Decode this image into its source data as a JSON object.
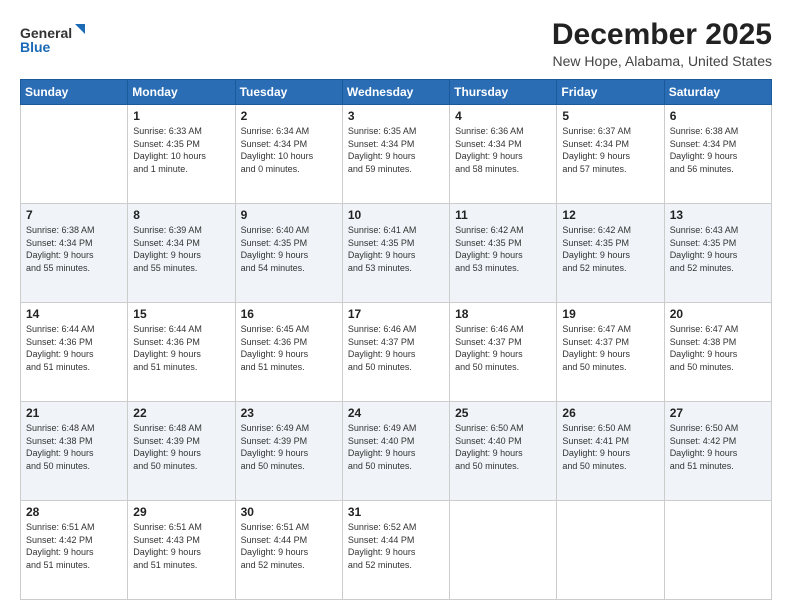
{
  "header": {
    "logo_line1": "General",
    "logo_line2": "Blue",
    "title": "December 2025",
    "subtitle": "New Hope, Alabama, United States"
  },
  "days_of_week": [
    "Sunday",
    "Monday",
    "Tuesday",
    "Wednesday",
    "Thursday",
    "Friday",
    "Saturday"
  ],
  "weeks": [
    [
      {
        "day": "",
        "content": ""
      },
      {
        "day": "1",
        "content": "Sunrise: 6:33 AM\nSunset: 4:35 PM\nDaylight: 10 hours\nand 1 minute."
      },
      {
        "day": "2",
        "content": "Sunrise: 6:34 AM\nSunset: 4:34 PM\nDaylight: 10 hours\nand 0 minutes."
      },
      {
        "day": "3",
        "content": "Sunrise: 6:35 AM\nSunset: 4:34 PM\nDaylight: 9 hours\nand 59 minutes."
      },
      {
        "day": "4",
        "content": "Sunrise: 6:36 AM\nSunset: 4:34 PM\nDaylight: 9 hours\nand 58 minutes."
      },
      {
        "day": "5",
        "content": "Sunrise: 6:37 AM\nSunset: 4:34 PM\nDaylight: 9 hours\nand 57 minutes."
      },
      {
        "day": "6",
        "content": "Sunrise: 6:38 AM\nSunset: 4:34 PM\nDaylight: 9 hours\nand 56 minutes."
      }
    ],
    [
      {
        "day": "7",
        "content": "Sunrise: 6:38 AM\nSunset: 4:34 PM\nDaylight: 9 hours\nand 55 minutes."
      },
      {
        "day": "8",
        "content": "Sunrise: 6:39 AM\nSunset: 4:34 PM\nDaylight: 9 hours\nand 55 minutes."
      },
      {
        "day": "9",
        "content": "Sunrise: 6:40 AM\nSunset: 4:35 PM\nDaylight: 9 hours\nand 54 minutes."
      },
      {
        "day": "10",
        "content": "Sunrise: 6:41 AM\nSunset: 4:35 PM\nDaylight: 9 hours\nand 53 minutes."
      },
      {
        "day": "11",
        "content": "Sunrise: 6:42 AM\nSunset: 4:35 PM\nDaylight: 9 hours\nand 53 minutes."
      },
      {
        "day": "12",
        "content": "Sunrise: 6:42 AM\nSunset: 4:35 PM\nDaylight: 9 hours\nand 52 minutes."
      },
      {
        "day": "13",
        "content": "Sunrise: 6:43 AM\nSunset: 4:35 PM\nDaylight: 9 hours\nand 52 minutes."
      }
    ],
    [
      {
        "day": "14",
        "content": "Sunrise: 6:44 AM\nSunset: 4:36 PM\nDaylight: 9 hours\nand 51 minutes."
      },
      {
        "day": "15",
        "content": "Sunrise: 6:44 AM\nSunset: 4:36 PM\nDaylight: 9 hours\nand 51 minutes."
      },
      {
        "day": "16",
        "content": "Sunrise: 6:45 AM\nSunset: 4:36 PM\nDaylight: 9 hours\nand 51 minutes."
      },
      {
        "day": "17",
        "content": "Sunrise: 6:46 AM\nSunset: 4:37 PM\nDaylight: 9 hours\nand 50 minutes."
      },
      {
        "day": "18",
        "content": "Sunrise: 6:46 AM\nSunset: 4:37 PM\nDaylight: 9 hours\nand 50 minutes."
      },
      {
        "day": "19",
        "content": "Sunrise: 6:47 AM\nSunset: 4:37 PM\nDaylight: 9 hours\nand 50 minutes."
      },
      {
        "day": "20",
        "content": "Sunrise: 6:47 AM\nSunset: 4:38 PM\nDaylight: 9 hours\nand 50 minutes."
      }
    ],
    [
      {
        "day": "21",
        "content": "Sunrise: 6:48 AM\nSunset: 4:38 PM\nDaylight: 9 hours\nand 50 minutes."
      },
      {
        "day": "22",
        "content": "Sunrise: 6:48 AM\nSunset: 4:39 PM\nDaylight: 9 hours\nand 50 minutes."
      },
      {
        "day": "23",
        "content": "Sunrise: 6:49 AM\nSunset: 4:39 PM\nDaylight: 9 hours\nand 50 minutes."
      },
      {
        "day": "24",
        "content": "Sunrise: 6:49 AM\nSunset: 4:40 PM\nDaylight: 9 hours\nand 50 minutes."
      },
      {
        "day": "25",
        "content": "Sunrise: 6:50 AM\nSunset: 4:40 PM\nDaylight: 9 hours\nand 50 minutes."
      },
      {
        "day": "26",
        "content": "Sunrise: 6:50 AM\nSunset: 4:41 PM\nDaylight: 9 hours\nand 50 minutes."
      },
      {
        "day": "27",
        "content": "Sunrise: 6:50 AM\nSunset: 4:42 PM\nDaylight: 9 hours\nand 51 minutes."
      }
    ],
    [
      {
        "day": "28",
        "content": "Sunrise: 6:51 AM\nSunset: 4:42 PM\nDaylight: 9 hours\nand 51 minutes."
      },
      {
        "day": "29",
        "content": "Sunrise: 6:51 AM\nSunset: 4:43 PM\nDaylight: 9 hours\nand 51 minutes."
      },
      {
        "day": "30",
        "content": "Sunrise: 6:51 AM\nSunset: 4:44 PM\nDaylight: 9 hours\nand 52 minutes."
      },
      {
        "day": "31",
        "content": "Sunrise: 6:52 AM\nSunset: 4:44 PM\nDaylight: 9 hours\nand 52 minutes."
      },
      {
        "day": "",
        "content": ""
      },
      {
        "day": "",
        "content": ""
      },
      {
        "day": "",
        "content": ""
      }
    ]
  ]
}
